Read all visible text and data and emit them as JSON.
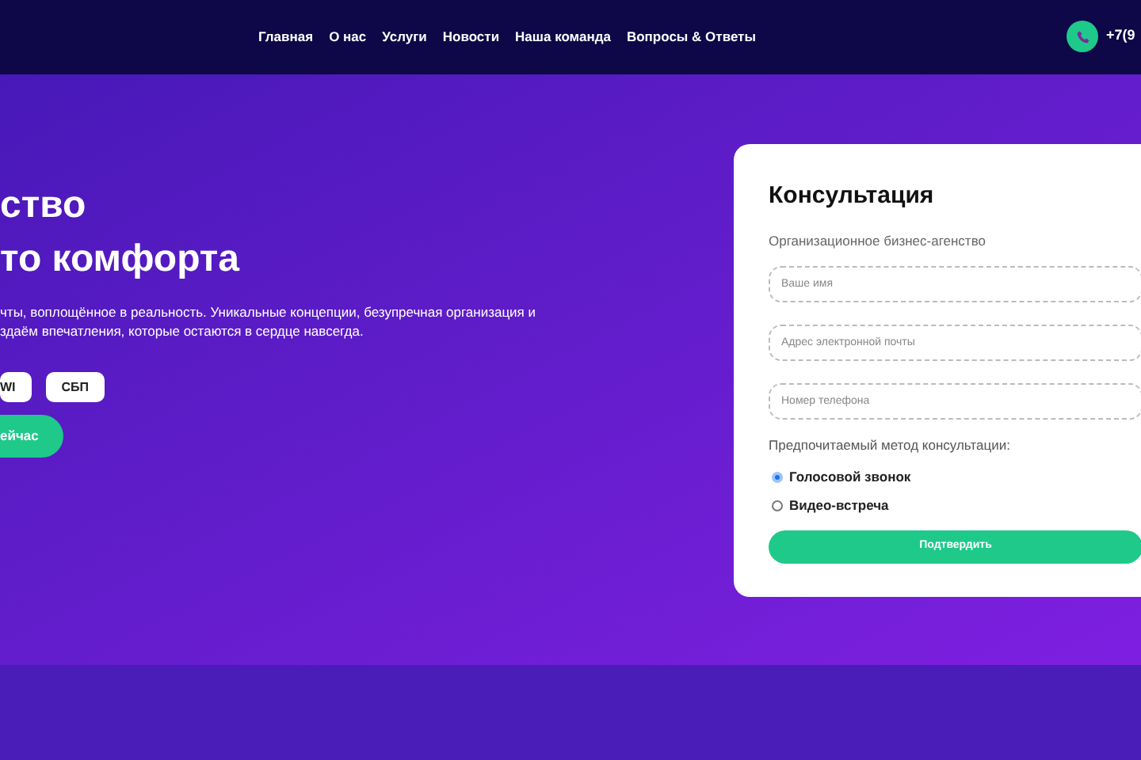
{
  "nav": {
    "items": [
      "Главная",
      "О нас",
      "Услуги",
      "Новости",
      "Наша команда",
      "Вопросы & Ответы"
    ],
    "phone": "+7(9"
  },
  "hero": {
    "title_lines": [
      "ство",
      "то комфорта"
    ],
    "text_lines": [
      "чты, воплощённое в реальность. Уникальные концепции, безупречная организация и",
      "здаём впечатления, которые остаются в сердце навсегда."
    ],
    "payments": [
      "WI",
      "СБП"
    ],
    "cta": "ейчас"
  },
  "form": {
    "title": "Консультация",
    "subtitle": "Организационное бизнес-агенство",
    "fields": [
      {
        "placeholder": "Ваше имя"
      },
      {
        "placeholder": "Адрес электронной почты"
      },
      {
        "placeholder": "Номер телефона"
      }
    ],
    "method_label": "Предпочитаемый метод консультации:",
    "options": [
      {
        "label": "Голосовой звонок",
        "selected": true
      },
      {
        "label": "Видео-встреча",
        "selected": false
      }
    ],
    "submit": "Подтвердить"
  }
}
